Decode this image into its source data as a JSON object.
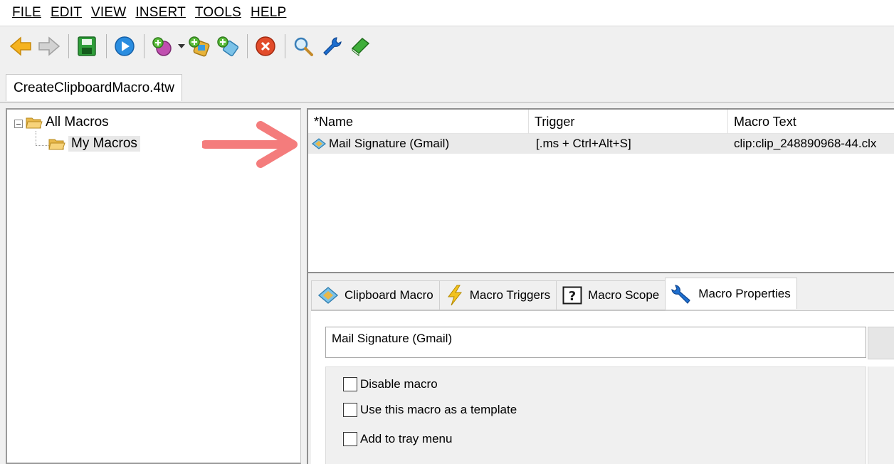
{
  "menu": [
    {
      "label": "FILE"
    },
    {
      "label": "EDIT"
    },
    {
      "label": "VIEW"
    },
    {
      "label": "INSERT"
    },
    {
      "label": "TOOLS"
    },
    {
      "label": "HELP"
    }
  ],
  "toolbar": {
    "icons": [
      "back-arrow-icon",
      "forward-arrow-icon",
      "save-icon",
      "play-icon",
      "new-macro-icon",
      "dropdown-icon",
      "new-clipboard-macro-icon",
      "new-text-macro-icon",
      "delete-icon",
      "search-icon",
      "wrench-icon",
      "book-icon"
    ]
  },
  "document": {
    "tab_label": "CreateClipboardMacro.4tw"
  },
  "tree": {
    "root_label": "All Macros",
    "child_label": "My Macros"
  },
  "list": {
    "columns": [
      "*Name",
      "Trigger",
      "Macro Text"
    ],
    "rows": [
      {
        "name": "Mail Signature (Gmail)",
        "trigger": "[.ms + Ctrl+Alt+S]",
        "text": "clip:clip_248890968-44.clx"
      }
    ]
  },
  "tabs": [
    {
      "label": "Clipboard Macro",
      "icon": "clipboard-macro-icon"
    },
    {
      "label": "Macro Triggers",
      "icon": "lightning-icon"
    },
    {
      "label": "Macro Scope",
      "icon": "question-icon"
    },
    {
      "label": "Macro Properties",
      "icon": "wrench-icon",
      "active": true
    }
  ],
  "properties": {
    "name_value": "Mail Signature (Gmail)",
    "options": [
      {
        "label": "Disable macro",
        "checked": false
      },
      {
        "label": "Use this macro as a template",
        "checked": false
      },
      {
        "label": "Add to tray menu",
        "checked": false
      }
    ]
  },
  "colors": {
    "annotation_arrow": "#f47c7c",
    "selection": "#eaeaea",
    "accent_blue": "#1e6fd0"
  }
}
